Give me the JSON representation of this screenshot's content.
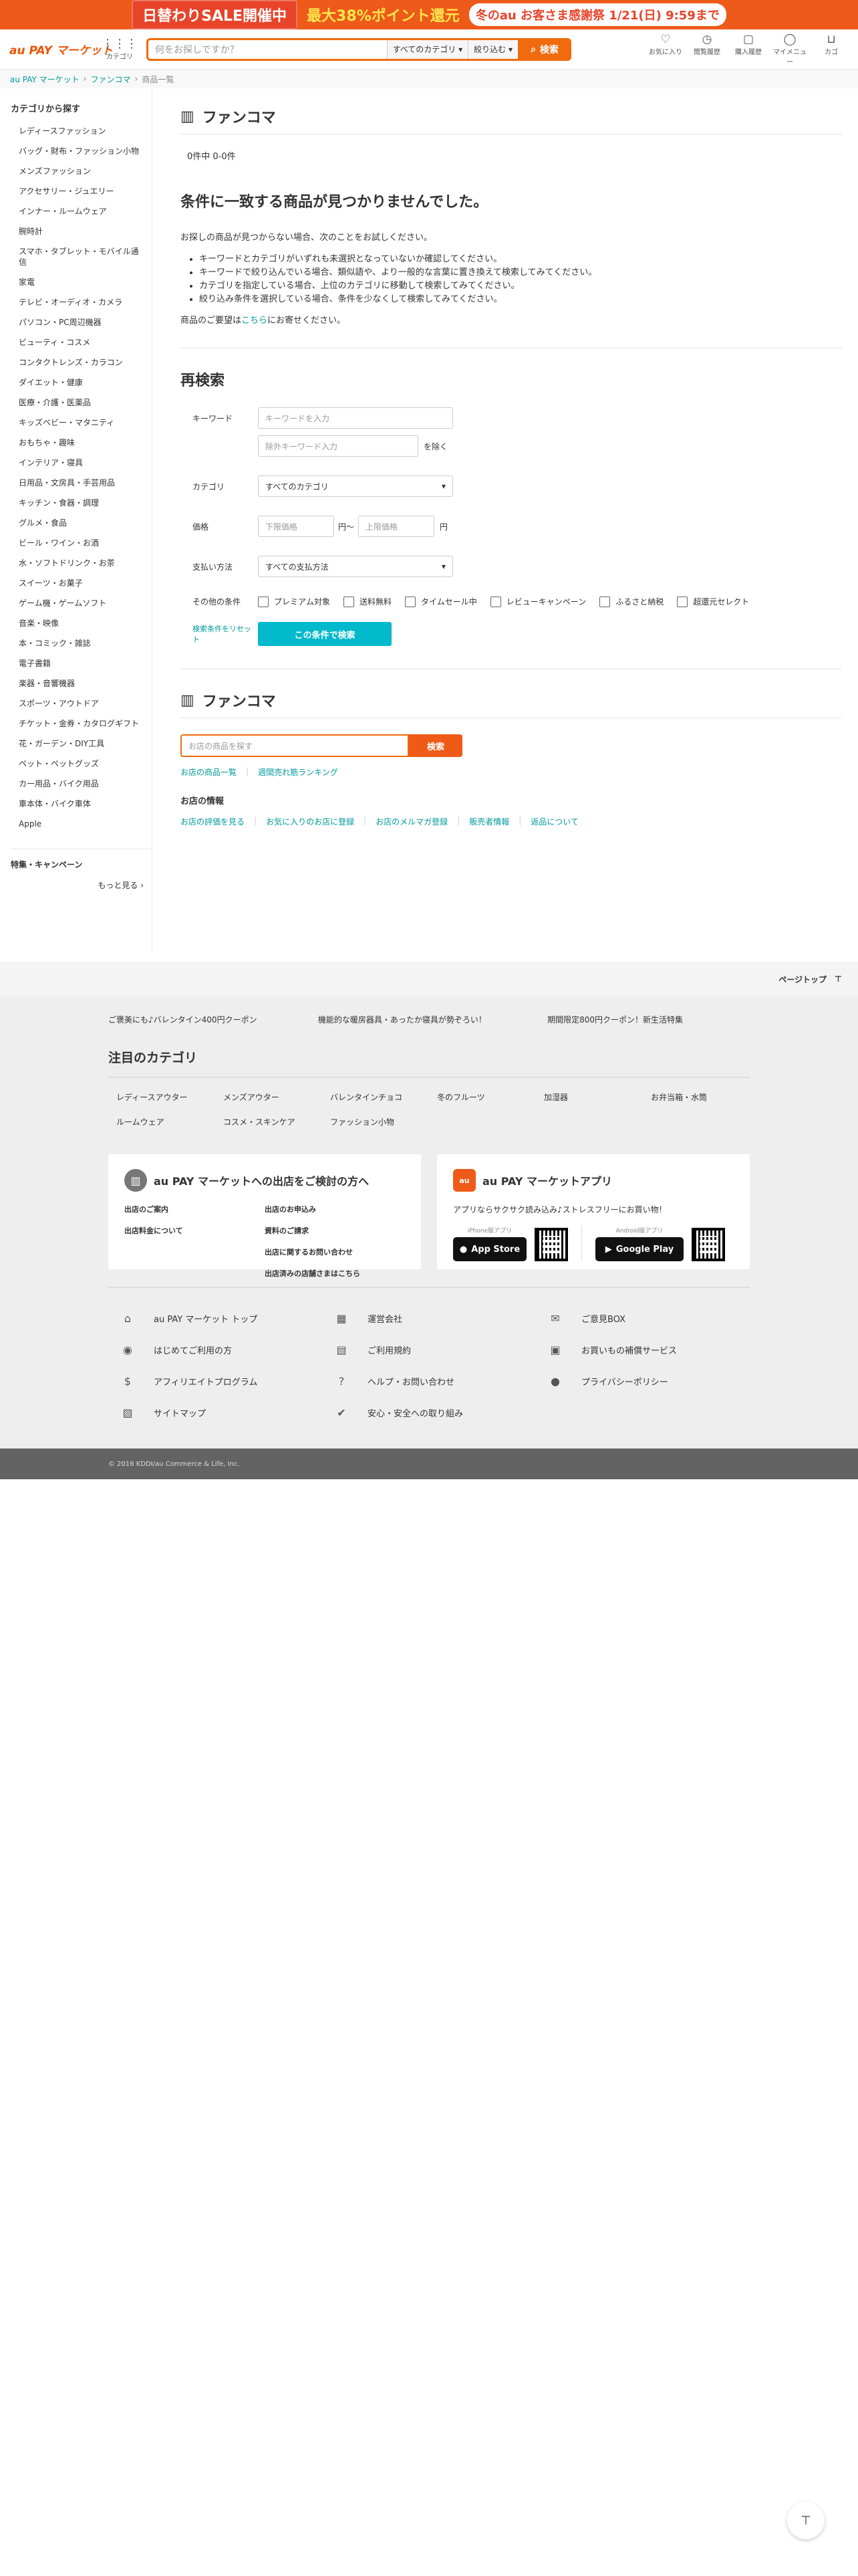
{
  "banner": {
    "sale": "日替わりSALE開催中",
    "points": "最大38%ポイント還元",
    "event": "冬のau お客さま感謝祭 1/21(日) 9:59まで"
  },
  "header": {
    "logo": "au PAY マーケット",
    "category_label": "カテゴリ",
    "search_placeholder": "何をお探しですか？",
    "category_select": "すべてのカテゴリ",
    "filter_label": "絞り込む",
    "search_button": "検索",
    "icons": [
      {
        "name": "heart-icon",
        "label": "お気に入り"
      },
      {
        "name": "history-icon",
        "label": "閲覧履歴"
      },
      {
        "name": "bag-icon",
        "label": "購入履歴"
      },
      {
        "name": "user-icon",
        "label": "マイメニュー"
      },
      {
        "name": "cart-icon",
        "label": "カゴ"
      }
    ]
  },
  "breadcrumb": [
    "au PAY マーケット",
    "ファンコマ",
    "商品一覧"
  ],
  "sidebar": {
    "title": "カテゴリから探す",
    "items": [
      "レディースファッション",
      "バッグ・財布・ファッション小物",
      "メンズファッション",
      "アクセサリー・ジュエリー",
      "インナー・ルームウェア",
      "腕時計",
      "スマホ・タブレット・モバイル通信",
      "家電",
      "テレビ・オーディオ・カメラ",
      "パソコン・PC周辺機器",
      "ビューティ・コスメ",
      "コンタクトレンズ・カラコン",
      "ダイエット・健康",
      "医療・介護・医薬品",
      "キッズベビー・マタニティ",
      "おもちゃ・趣味",
      "インテリア・寝具",
      "日用品・文房具・手芸用品",
      "キッチン・食器・調理",
      "グルメ・食品",
      "ビール・ワイン・お酒",
      "水・ソフトドリンク・お茶",
      "スイーツ・お菓子",
      "ゲーム機・ゲームソフト",
      "音楽・映像",
      "本・コミック・雑誌",
      "電子書籍",
      "楽器・音響機器",
      "スポーツ・アウトドア",
      "チケット・金券・カタログギフト",
      "花・ガーデン・DIY工具",
      "ペット・ペットグッズ",
      "カー用品・バイク用品",
      "車本体・バイク車体",
      "Apple"
    ],
    "feature": "特集・キャンペーン",
    "more": "もっと見る"
  },
  "main": {
    "shop_name": "ファンコマ",
    "count": "0件中 0-0件",
    "no_result": "条件に一致する商品が見つかりませんでした。",
    "tips_intro": "お探しの商品が見つからない場合、次のことをお試しください。",
    "tips": [
      "キーワードとカテゴリがいずれも未選択となっていないか確認してください。",
      "キーワードで絞り込んでいる場合、類似語や、より一般的な言葉に置き換えて検索してみてください。",
      "カテゴリを指定している場合、上位のカテゴリに移動して検索してみてください。",
      "絞り込み条件を選択している場合、条件を少なくして検索してみてください。"
    ],
    "request_pre": "商品のご要望は",
    "request_link": "こちら",
    "request_post": "にお寄せください。"
  },
  "research": {
    "title": "再検索",
    "keyword_label": "キーワード",
    "keyword_placeholder": "キーワードを入力",
    "exclude_placeholder": "除外キーワード入力",
    "exclude_suffix": "を除く",
    "category_label": "カテゴリ",
    "category_value": "すべてのカテゴリ",
    "price_label": "価格",
    "price_min": "下限価格",
    "price_max": "上限価格",
    "yen_range": "円〜",
    "yen": "円",
    "payment_label": "支払い方法",
    "payment_value": "すべての支払方法",
    "other_label": "その他の条件",
    "checks": [
      "プレミアム対象",
      "送料無料",
      "タイムセール中",
      "レビューキャンペーン",
      "ふるさと納税",
      "超還元セレクト"
    ],
    "reset": "検索条件をリセット",
    "submit": "この条件で検索"
  },
  "shop": {
    "name": "ファンコマ",
    "search_placeholder": "お店の商品を探す",
    "search_button": "検索",
    "links": [
      "お店の商品一覧",
      "週間売れ筋ランキング"
    ],
    "info_title": "お店の情報",
    "info_links": [
      "お店の評価を見る",
      "お気に入りのお店に登録",
      "お店のメルマガ登録",
      "販売者情報",
      "返品について"
    ]
  },
  "footer": {
    "page_top": "ページトップ",
    "promos": [
      "ご褒美にも♪バレンタイン400円クーポン",
      "機能的な暖房器具・あったか寝具が勢ぞろい！",
      "期間限定800円クーポン！新生活特集"
    ],
    "attention_title": "注目のカテゴリ",
    "attention": [
      "レディースアウター",
      "メンズアウター",
      "バレンタインチョコ",
      "冬のフルーツ",
      "加湿器",
      "お弁当箱・水筒",
      "ルームウェア",
      "コスメ・スキンケア",
      "ファッション小物"
    ],
    "seller_title": "au PAY マーケットへの出店をご検討の方へ",
    "seller_links": [
      "出店のご案内",
      "出店のお申込み",
      "出店料金について",
      "資料のご請求",
      "",
      "出店に関するお問い合わせ",
      "",
      "出店済みの店舗さまはこちら"
    ],
    "app_title": "au PAY マーケットアプリ",
    "app_desc": "アプリならサクサク読み込み♪ストレスフリーにお買い物！",
    "iphone_tag": "iPhone版アプリ",
    "android_tag": "Android版アプリ",
    "appstore": "App Store",
    "googleplay": "Google Play",
    "nav": [
      {
        "icon": "home-icon",
        "glyph": "⌂",
        "label": "au PAY マーケット トップ"
      },
      {
        "icon": "building-icon",
        "glyph": "▦",
        "label": "運営会社"
      },
      {
        "icon": "comment-icon",
        "glyph": "✉",
        "label": "ご意見BOX"
      },
      {
        "icon": "compass-icon",
        "glyph": "◉",
        "label": "はじめてご利用の方"
      },
      {
        "icon": "document-icon",
        "glyph": "▤",
        "label": "ご利用規約"
      },
      {
        "icon": "shield-bag-icon",
        "glyph": "▣",
        "label": "お買いもの補償サービス"
      },
      {
        "icon": "money-icon",
        "glyph": "$",
        "label": "アフィリエイトプログラム"
      },
      {
        "icon": "help-icon",
        "glyph": "?",
        "label": "ヘルプ・お問い合わせ"
      },
      {
        "icon": "lock-icon",
        "glyph": "●",
        "label": "プライバシーポリシー"
      },
      {
        "icon": "map-icon",
        "glyph": "▧",
        "label": "サイトマップ"
      },
      {
        "icon": "safety-icon",
        "glyph": "✔",
        "label": "安心・安全への取り組み"
      }
    ],
    "copyright": "© 2016 KDDI/au Commerce & Life, Inc."
  }
}
